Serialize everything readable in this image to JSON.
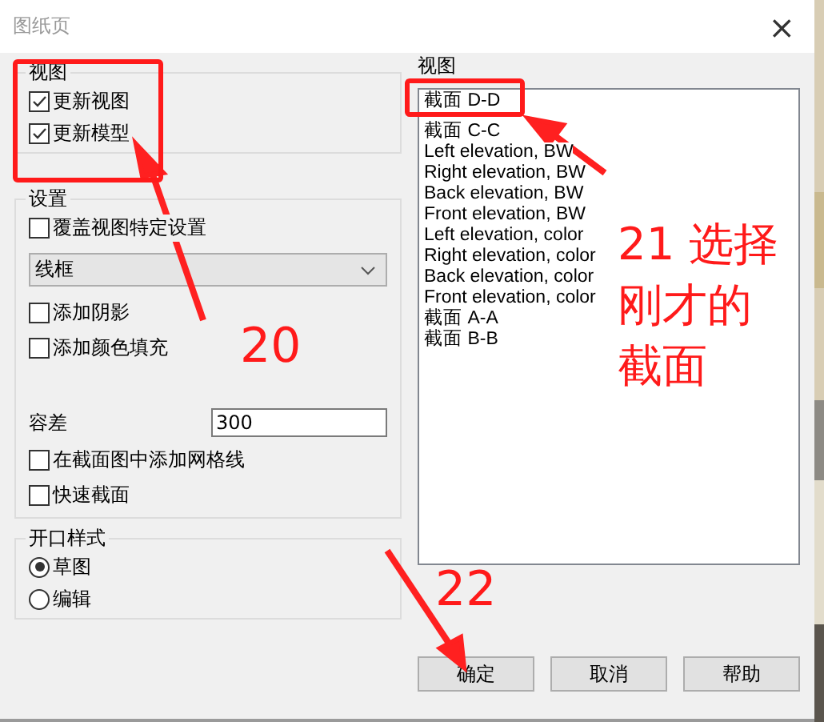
{
  "window": {
    "title": "图纸页",
    "close": "×"
  },
  "view_group": {
    "title": "视图",
    "options": [
      {
        "label": "更新视图",
        "checked": true
      },
      {
        "label": "更新模型",
        "checked": true
      }
    ]
  },
  "settings_group": {
    "title": "设置",
    "override": {
      "label": "覆盖视图特定设置",
      "checked": false
    },
    "style_select": {
      "value": "线框"
    },
    "options_a": [
      {
        "label": "添加阴影",
        "checked": false
      },
      {
        "label": "添加颜色填充",
        "checked": false
      }
    ],
    "tolerance": {
      "label": "容差",
      "value": "300"
    },
    "options_b": [
      {
        "label": "在截面图中添加网格线",
        "checked": false
      },
      {
        "label": "快速截面",
        "checked": false
      }
    ]
  },
  "opening_style": {
    "title": "开口样式",
    "options": [
      {
        "label": "草图",
        "selected": true
      },
      {
        "label": "编辑",
        "selected": false
      }
    ]
  },
  "views_list": {
    "title": "视图",
    "items": [
      "截面 D-D",
      "截面 C-C",
      "Left elevation, BW",
      "Right elevation, BW",
      "Back elevation, BW",
      "Front elevation, BW",
      "Left elevation, color",
      "Right elevation, color",
      "Back elevation, color",
      "Front elevation, color",
      "截面 A-A",
      "截面 B-B"
    ]
  },
  "buttons": [
    "确定",
    "取消",
    "帮助"
  ],
  "annotations": [
    {
      "kind": "number",
      "text": "20"
    },
    {
      "kind": "note",
      "text": "21 选择刚才的截面"
    },
    {
      "kind": "number",
      "text": "22"
    }
  ]
}
